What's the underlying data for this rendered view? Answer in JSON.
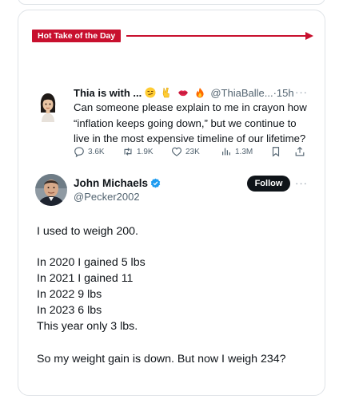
{
  "banner": {
    "label": "Hot Take of the Day",
    "color": "#c8102e"
  },
  "quoted_tweet": {
    "name": "Thia is with ...",
    "emojis": [
      "smirk-emoji",
      "victory-hand-emoji",
      "lips-emoji",
      "fire-emoji"
    ],
    "handle_time": "@ThiaBalle...·15h",
    "more": "···",
    "text": "Can someone please explain to me in crayon how “inflation keeps going down,” but we continue to live in the most expensive timeline of our lifetime?",
    "actions": {
      "replies": "3.6K",
      "retweets": "1.9K",
      "likes": "23K",
      "views": "1.3M"
    }
  },
  "main_tweet": {
    "name": "John Michaels",
    "handle": "@Pecker2002",
    "follow_label": "Follow",
    "more": "···",
    "verified_color": "#1d9bf0",
    "lines": [
      "I used to weigh 200.",
      "In 2020 I gained 5 lbs",
      "In 2021 I gained 11",
      "In 2022 9 lbs",
      "In 2023 6 lbs",
      "This year only 3 lbs.",
      "So my weight gain is down. But now I weigh 234?"
    ]
  }
}
